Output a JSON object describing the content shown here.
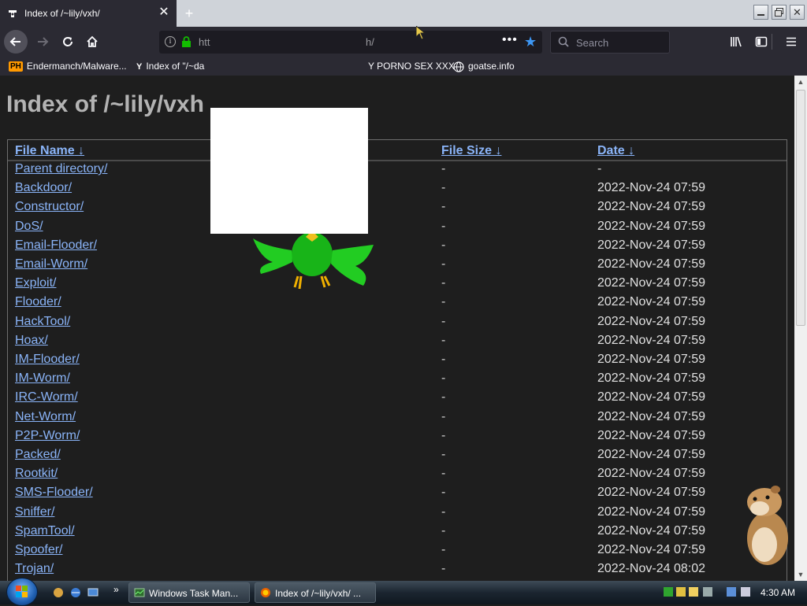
{
  "browser": {
    "tab_title": "Index of /~lily/vxh/",
    "tab_close": "✕",
    "new_tab": "+",
    "url_text": "htt",
    "url_tail": "h/",
    "search_placeholder": "Search",
    "menu_dots": "•••"
  },
  "bookmarks": [
    {
      "label": "Endermanch/Malware...",
      "icon": "ph-icon"
    },
    {
      "label": "Index of \"/~da",
      "icon": "yp-icon"
    },
    {
      "label": "Y PORNO SEX XXX",
      "icon": "none"
    },
    {
      "label": "goatse.info",
      "icon": "globe-icon"
    }
  ],
  "page": {
    "heading": "Index of /~lily/vxh",
    "columns": {
      "name": "File Name",
      "size": "File Size",
      "date": "Date",
      "sort_arrow": "↓"
    },
    "rows": [
      {
        "name": "Parent directory/",
        "size": "-",
        "date": "-"
      },
      {
        "name": "Backdoor/",
        "size": "-",
        "date": "2022-Nov-24 07:59"
      },
      {
        "name": "Constructor/",
        "size": "-",
        "date": "2022-Nov-24 07:59"
      },
      {
        "name": "DoS/",
        "size": "-",
        "date": "2022-Nov-24 07:59"
      },
      {
        "name": "Email-Flooder/",
        "size": "-",
        "date": "2022-Nov-24 07:59"
      },
      {
        "name": "Email-Worm/",
        "size": "-",
        "date": "2022-Nov-24 07:59"
      },
      {
        "name": "Exploit/",
        "size": "-",
        "date": "2022-Nov-24 07:59"
      },
      {
        "name": "Flooder/",
        "size": "-",
        "date": "2022-Nov-24 07:59"
      },
      {
        "name": "HackTool/",
        "size": "-",
        "date": "2022-Nov-24 07:59"
      },
      {
        "name": "Hoax/",
        "size": "-",
        "date": "2022-Nov-24 07:59"
      },
      {
        "name": "IM-Flooder/",
        "size": "-",
        "date": "2022-Nov-24 07:59"
      },
      {
        "name": "IM-Worm/",
        "size": "-",
        "date": "2022-Nov-24 07:59"
      },
      {
        "name": "IRC-Worm/",
        "size": "-",
        "date": "2022-Nov-24 07:59"
      },
      {
        "name": "Net-Worm/",
        "size": "-",
        "date": "2022-Nov-24 07:59"
      },
      {
        "name": "P2P-Worm/",
        "size": "-",
        "date": "2022-Nov-24 07:59"
      },
      {
        "name": "Packed/",
        "size": "-",
        "date": "2022-Nov-24 07:59"
      },
      {
        "name": "Rootkit/",
        "size": "-",
        "date": "2022-Nov-24 07:59"
      },
      {
        "name": "SMS-Flooder/",
        "size": "-",
        "date": "2022-Nov-24 07:59"
      },
      {
        "name": "Sniffer/",
        "size": "-",
        "date": "2022-Nov-24 07:59"
      },
      {
        "name": "SpamTool/",
        "size": "-",
        "date": "2022-Nov-24 07:59"
      },
      {
        "name": "Spoofer/",
        "size": "-",
        "date": "2022-Nov-24 07:59"
      },
      {
        "name": "Trojan/",
        "size": "-",
        "date": "2022-Nov-24 08:02"
      }
    ]
  },
  "taskbar": {
    "items": [
      {
        "label": "Windows Task Man...",
        "icon": "task-manager-icon"
      },
      {
        "label": "Index of /~lily/vxh/ ...",
        "icon": "firefox-icon"
      }
    ],
    "more": "»",
    "clock": "4:30 AM"
  },
  "colors": {
    "page_bg": "#1e1e1e",
    "link": "#8ab4f8",
    "chrome": "#2b2a33",
    "heading": "#b3b3b3"
  }
}
